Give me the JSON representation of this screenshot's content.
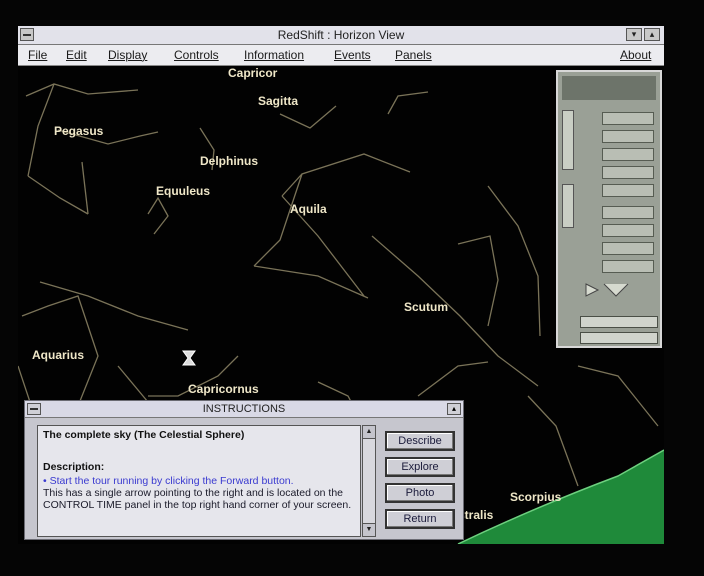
{
  "window": {
    "title": "RedShift : Horizon View",
    "controls": {
      "system": "▬",
      "minimize": "▾",
      "maximize": "▴"
    }
  },
  "menu": [
    "File",
    "Edit",
    "Display",
    "Controls",
    "Information",
    "Events",
    "Panels",
    "About"
  ],
  "constellations": {
    "capricornus_top": "Capricor",
    "sagitta": "Sagitta",
    "pegasus": "Pegasus",
    "delphinus": "Delphinus",
    "equuleus": "Equuleus",
    "aquila": "Aquila",
    "scutum": "Scutum",
    "aquarius": "Aquarius",
    "capricornus": "Capricornus",
    "scorpius": "Scorpius",
    "australis": "stralis"
  },
  "instructions": {
    "title": "INSTRUCTIONS",
    "heading": "The complete sky (The Celestial Sphere)",
    "description_label": "Description:",
    "bullet": "• Start the tour running by clicking the Forward button.",
    "body": "This has a single arrow pointing to the right and is located on the CONTROL TIME panel in the top right hand corner of your screen.",
    "buttons": {
      "describe": "Describe",
      "explore": "Explore",
      "photo": "Photo",
      "return": "Return"
    }
  },
  "colors": {
    "sky": "#020202",
    "constellation_label": "#efe7c8",
    "constellation_line": "#7a7358",
    "horizon": "#1f8a3a",
    "link_text": "#3a3ad0"
  }
}
